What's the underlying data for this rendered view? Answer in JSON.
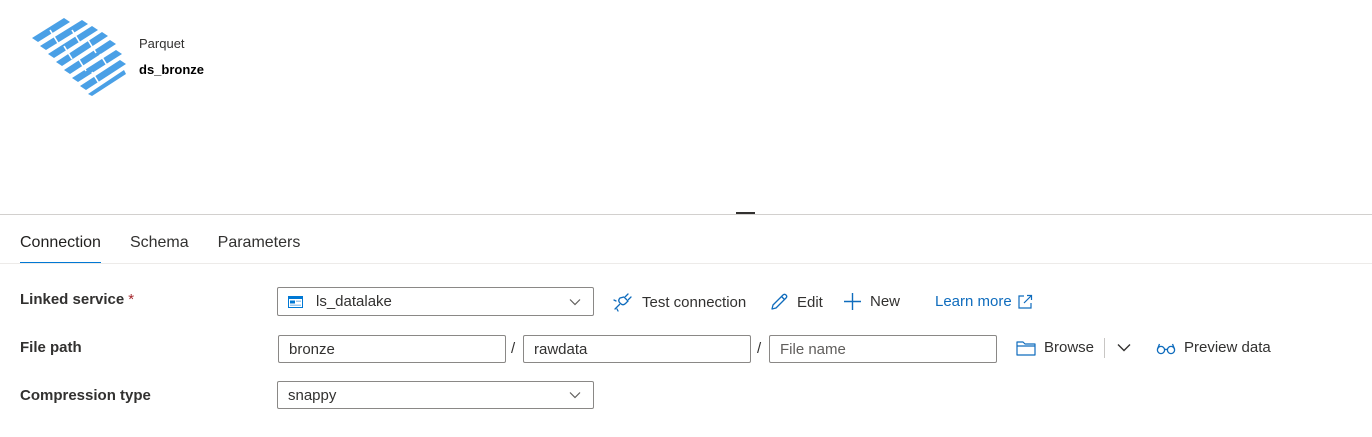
{
  "header": {
    "dataset_type": "Parquet",
    "dataset_name": "ds_bronze",
    "logo_icon": "parquet-logo-icon",
    "logo_color": "#4aa0e6"
  },
  "tabs": [
    {
      "label": "Connection",
      "active": true
    },
    {
      "label": "Schema",
      "active": false
    },
    {
      "label": "Parameters",
      "active": false
    }
  ],
  "form": {
    "linked_service": {
      "label": "Linked service",
      "required_marker": "*",
      "value": "ls_datalake",
      "icon": "storage-icon"
    },
    "actions": {
      "test_connection": "Test connection",
      "edit": "Edit",
      "new": "New",
      "learn_more": "Learn more"
    },
    "file_path": {
      "label": "File path",
      "container": "bronze",
      "directory": "rawdata",
      "file_name_placeholder": "File name",
      "separator": "/",
      "browse": "Browse",
      "preview": "Preview data"
    },
    "compression": {
      "label": "Compression type",
      "value": "snappy"
    }
  },
  "colors": {
    "accent": "#0078d4",
    "link": "#0f6cbd",
    "required": "#a4262c"
  }
}
